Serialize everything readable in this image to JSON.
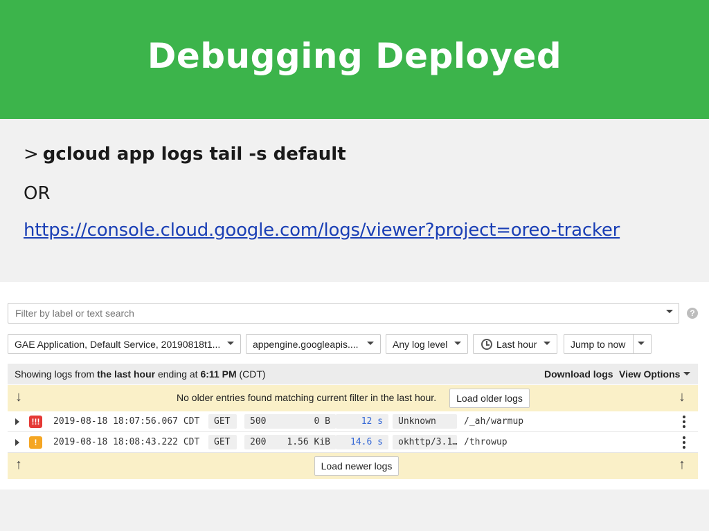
{
  "slide": {
    "title": "Debugging Deployed",
    "prompt": ">",
    "command": "gcloud app logs tail -s default",
    "or_text": "OR",
    "url": "https://console.cloud.google.com/logs/viewer?project=oreo-tracker"
  },
  "colors": {
    "banner": "#3cb44b",
    "error_severity": "#e53935",
    "warning_severity": "#f5a623",
    "latency": "#3367d6",
    "yellow_bar": "#faf0c8"
  },
  "logs_viewer": {
    "filter": {
      "placeholder": "Filter by label or text search",
      "value": ""
    },
    "help_icon": "?",
    "resource_select": "GAE Application, Default Service, 20190818t1...",
    "log_select": "appengine.googleapis....",
    "level_select": "Any log level",
    "time_select": "Last hour",
    "jump_button": "Jump to now",
    "status": {
      "prefix": "Showing logs from ",
      "bold1": "the last hour",
      "middle": " ending at ",
      "bold2": "6:11 PM",
      "suffix": " (CDT)"
    },
    "download_logs": "Download logs",
    "view_options": "View Options",
    "older_bar": {
      "message": "No older entries found matching current filter in the last hour.",
      "button": "Load older logs",
      "icon": "arrow-down-icon"
    },
    "newer_bar": {
      "button": "Load newer logs",
      "icon": "arrow-up-icon"
    },
    "entries": [
      {
        "severity": "error",
        "severity_glyph": "!!!",
        "timestamp": "2019-08-18 18:07:56.067 CDT",
        "method": "GET",
        "status": "500",
        "size": "0 B",
        "latency": "12 s",
        "user_agent": "Unknown",
        "path": "/_ah/warmup"
      },
      {
        "severity": "warning",
        "severity_glyph": "!",
        "timestamp": "2019-08-18 18:08:43.222 CDT",
        "method": "GET",
        "status": "200",
        "size": "1.56 KiB",
        "latency": "14.6 s",
        "user_agent": "okhttp/3.1…",
        "path": "/throwup"
      }
    ]
  }
}
